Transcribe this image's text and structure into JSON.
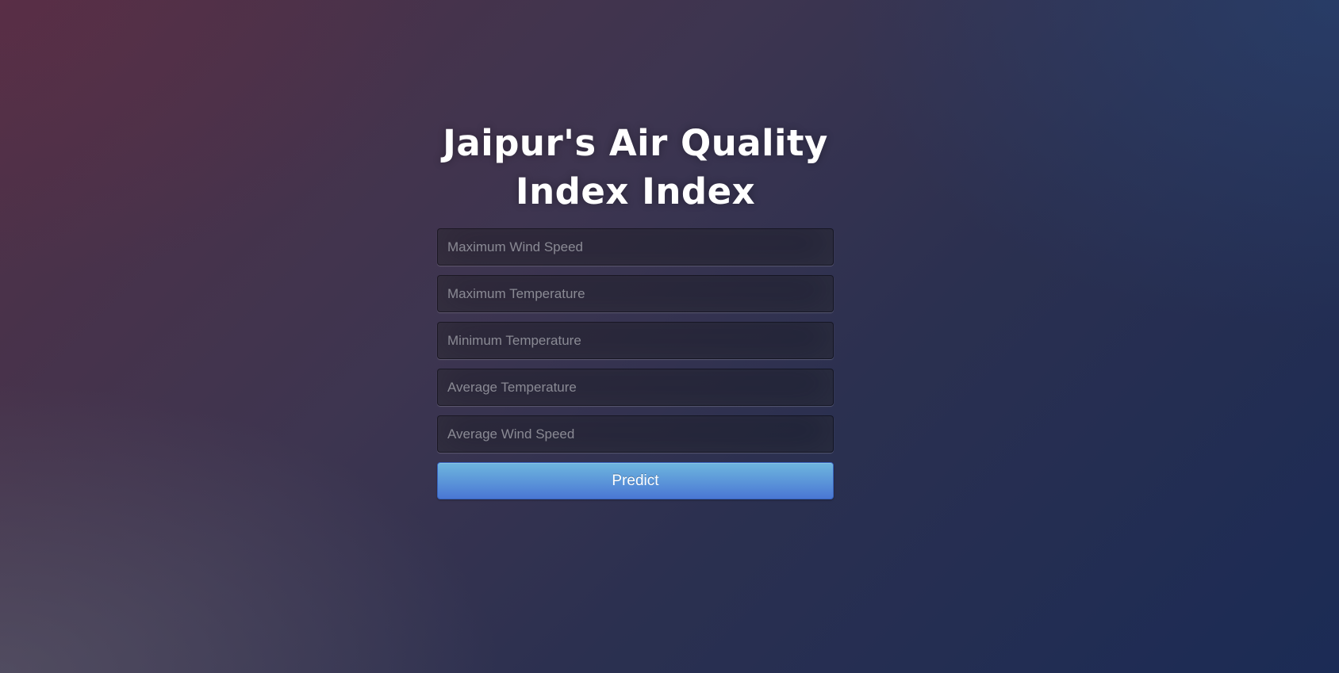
{
  "page": {
    "title": "Jaipur's Air Quality Index Index"
  },
  "form": {
    "fields": [
      {
        "placeholder": "Maximum Wind Speed",
        "value": ""
      },
      {
        "placeholder": "Maximum Temperature",
        "value": ""
      },
      {
        "placeholder": "Minimum Temperature",
        "value": ""
      },
      {
        "placeholder": "Average Temperature",
        "value": ""
      },
      {
        "placeholder": "Average Wind Speed",
        "value": ""
      }
    ],
    "submit_label": "Predict"
  },
  "colors": {
    "button_top": "#6eb6de",
    "button_bottom": "#4a77d4",
    "title_text": "#ffffff"
  }
}
